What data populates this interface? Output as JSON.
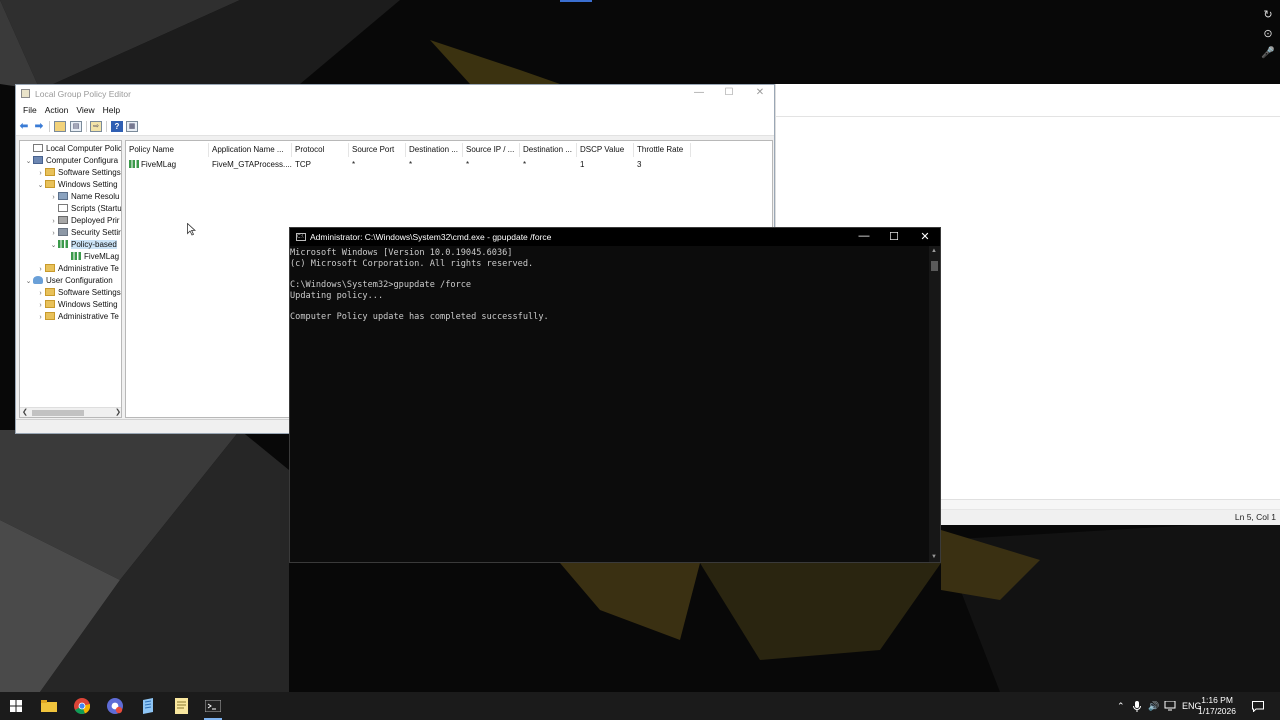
{
  "desktop": {
    "side_icons": [
      "↻",
      "⊙",
      "🎤"
    ]
  },
  "notepad": {
    "status": "Ln 5, Col 1"
  },
  "gpe": {
    "title": "Local Group Policy Editor",
    "menu": [
      "File",
      "Action",
      "View",
      "Help"
    ],
    "tree": [
      {
        "label": "Local Computer Policy",
        "icon": "doc",
        "indent": 0,
        "exp": ""
      },
      {
        "label": "Computer Configura",
        "icon": "computer",
        "indent": 0,
        "exp": "v"
      },
      {
        "label": "Software Settings",
        "icon": "folder",
        "indent": 1,
        "exp": ">"
      },
      {
        "label": "Windows Setting",
        "icon": "folder",
        "indent": 1,
        "exp": "v"
      },
      {
        "label": "Name Resolu",
        "icon": "netw",
        "indent": 2,
        "exp": ">"
      },
      {
        "label": "Scripts (Startu",
        "icon": "doc",
        "indent": 2,
        "exp": ""
      },
      {
        "label": "Deployed Prir",
        "icon": "printer",
        "indent": 2,
        "exp": ">"
      },
      {
        "label": "Security Settir",
        "icon": "lock",
        "indent": 2,
        "exp": ">"
      },
      {
        "label": "Policy-based",
        "icon": "chart",
        "indent": 2,
        "exp": "v",
        "selected": true
      },
      {
        "label": "FiveMLag",
        "icon": "chart",
        "indent": 3,
        "exp": ""
      },
      {
        "label": "Administrative Te",
        "icon": "folder",
        "indent": 1,
        "exp": ">"
      },
      {
        "label": "User Configuration",
        "icon": "user",
        "indent": 0,
        "exp": "v"
      },
      {
        "label": "Software Settings",
        "icon": "folder",
        "indent": 1,
        "exp": ">"
      },
      {
        "label": "Windows Setting",
        "icon": "folder",
        "indent": 1,
        "exp": ">"
      },
      {
        "label": "Administrative Te",
        "icon": "folder",
        "indent": 1,
        "exp": ">"
      }
    ],
    "columns": [
      "Policy Name",
      "Application Name ...",
      "Protocol",
      "Source Port",
      "Destination ...",
      "Source IP / ...",
      "Destination ...",
      "DSCP Value",
      "Throttle Rate"
    ],
    "rows": [
      [
        "FiveMLag",
        "FiveM_GTAProcess....",
        "TCP",
        "*",
        "*",
        "*",
        "*",
        "1",
        "3"
      ]
    ]
  },
  "cmd": {
    "title": "Administrator: C:\\Windows\\System32\\cmd.exe - gpupdate  /force",
    "lines": [
      "Microsoft Windows [Version 10.0.19045.6036]",
      "(c) Microsoft Corporation. All rights reserved.",
      "",
      "C:\\Windows\\System32>gpupdate /force",
      "Updating policy...",
      "",
      "Computer Policy update has completed successfully."
    ]
  },
  "taskbar": {
    "apps": [
      "start-icon",
      "file-explorer-icon",
      "chrome-icon",
      "chrome-profile-icon",
      "notepad-icon",
      "sticky-notes-icon",
      "cmd-icon"
    ],
    "language": "ENG",
    "time": "1:16 PM",
    "date": "1/17/2026"
  }
}
